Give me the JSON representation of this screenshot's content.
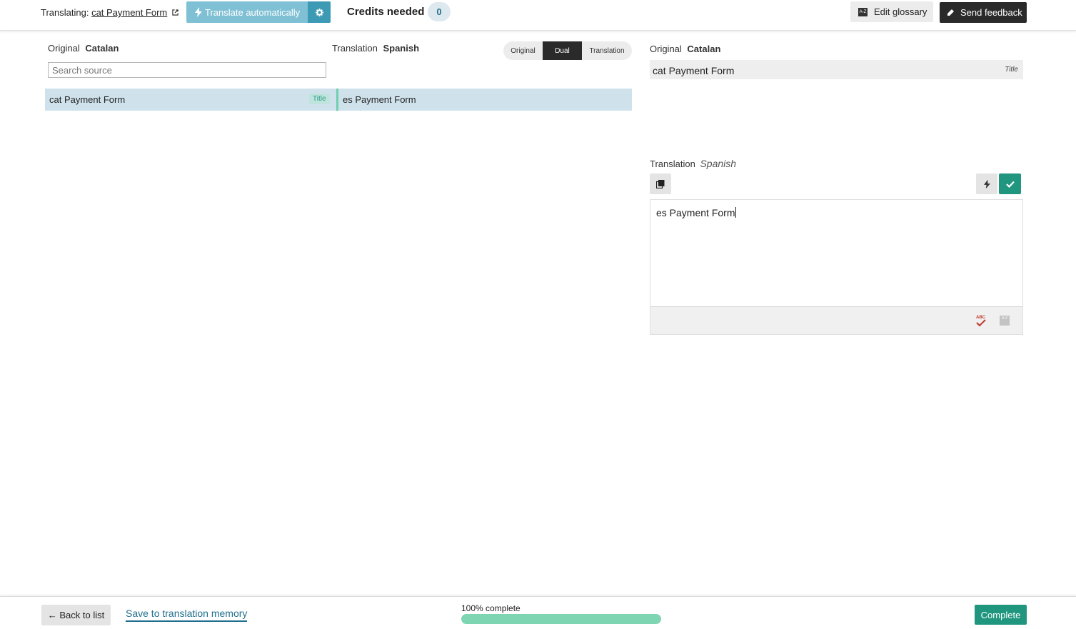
{
  "topbar": {
    "translating_label": "Translating:",
    "document_name": "cat Payment Form",
    "translate_auto_label": "Translate automatically",
    "credits_label": "Credits needed",
    "credits_value": "0",
    "edit_glossary_label": "Edit glossary",
    "send_feedback_label": "Send feedback"
  },
  "left_panel": {
    "original_label": "Original",
    "original_language": "Catalan",
    "translation_label": "Translation",
    "translation_language": "Spanish",
    "view_toggle": [
      "Original",
      "Dual",
      "Translation"
    ],
    "view_selected": "Dual",
    "search_placeholder": "Search source",
    "rows": [
      {
        "source": "cat Payment Form",
        "tag": "Title",
        "target": "es Payment Form"
      }
    ]
  },
  "right_panel": {
    "original_label": "Original",
    "original_language": "Catalan",
    "original_text": "cat Payment Form",
    "original_tag": "Title",
    "translation_label": "Translation",
    "translation_language": "Spanish",
    "translation_text": "es Payment Form"
  },
  "bottombar": {
    "back_label": "← Back to list",
    "save_memory_label": "Save to translation memory",
    "progress_label": "100% complete",
    "progress_percent": 100,
    "complete_label": "Complete"
  },
  "colors": {
    "accent_teal": "#20967e",
    "auto_blue": "#7fc0d4",
    "auto_blue_dark": "#3d9ab5",
    "row_selected": "#cfe2ec",
    "progress_fill": "#7ed5b2"
  }
}
